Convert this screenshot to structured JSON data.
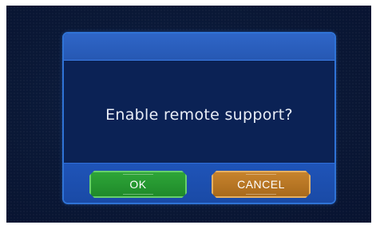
{
  "dialog": {
    "message": "Enable remote support?",
    "buttons": {
      "ok_label": "OK",
      "cancel_label": "CANCEL"
    }
  },
  "colors": {
    "background": "#0a1836",
    "dialog_body": "#0b2255",
    "dialog_border": "#2f73d6",
    "header": "#2658b3",
    "ok_button": "#1f8a2a",
    "cancel_button": "#a86a1c"
  }
}
